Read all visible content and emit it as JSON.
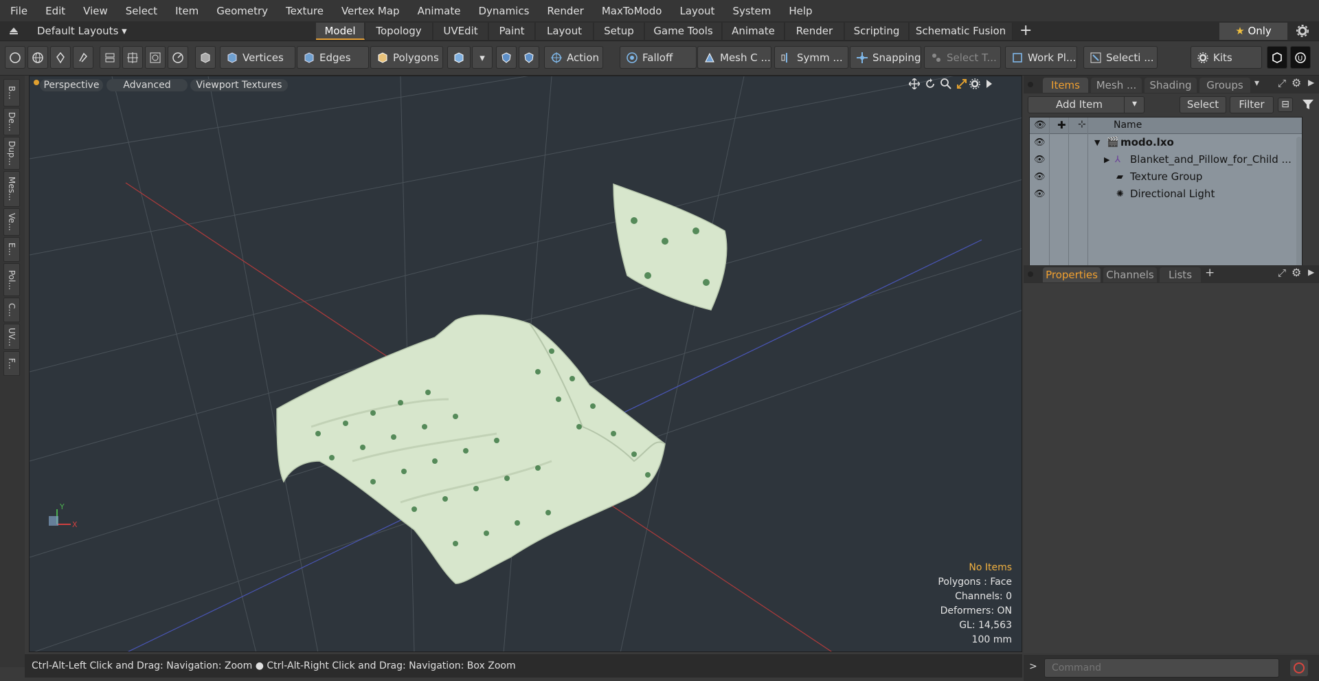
{
  "menu": [
    "File",
    "Edit",
    "View",
    "Select",
    "Item",
    "Geometry",
    "Texture",
    "Vertex Map",
    "Animate",
    "Dynamics",
    "Render",
    "MaxToModo",
    "Layout",
    "System",
    "Help"
  ],
  "layout_selector": "Default Layouts",
  "layout_tabs": [
    "Model",
    "Topology",
    "UVEdit",
    "Paint",
    "Layout",
    "Setup",
    "Game Tools",
    "Animate",
    "Render",
    "Scripting",
    "Schematic Fusion"
  ],
  "layout_tab_active": "Model",
  "only_label": "Only",
  "toolbar": {
    "vertices": "Vertices",
    "edges": "Edges",
    "polygons": "Polygons",
    "action": "Action ...",
    "falloff": "Falloff",
    "mesh_c": "Mesh C ...",
    "symm": "Symm ...",
    "snapping": "Snapping",
    "select_t": "Select T...",
    "work_pl": "Work Pl...",
    "selecti": "Selecti ...",
    "kits": "Kits"
  },
  "left_tabs": [
    "B...",
    "De...",
    "Dup...",
    "Mes...",
    "Ve...",
    "E...",
    "Pol...",
    "C...",
    "UV...",
    "F..."
  ],
  "viewport": {
    "perspective": "Perspective",
    "advanced": "Advanced",
    "viewport_textures": "Viewport Textures",
    "stats": [
      "No Items",
      "Polygons : Face",
      "Channels: 0",
      "Deformers: ON",
      "GL: 14,563",
      "100 mm"
    ],
    "accent_color": "#f0b040"
  },
  "status_text": "Ctrl-Alt-Left Click and Drag: Navigation: Zoom ● Ctrl-Alt-Right Click and Drag: Navigation: Box Zoom",
  "items_panel": {
    "tabs": [
      "Items",
      "Mesh ...",
      "Shading",
      "Groups"
    ],
    "active_tab": "Items",
    "add_item": "Add Item",
    "select": "Select",
    "filter": "Filter",
    "name_header": "Name",
    "rows": [
      "modo.lxo",
      "Blanket_and_Pillow_for_Child ...",
      "Texture Group",
      "Directional Light"
    ]
  },
  "props_panel": {
    "tabs": [
      "Properties",
      "Channels",
      "Lists"
    ],
    "active_tab": "Properties"
  },
  "command_placeholder": "Command"
}
